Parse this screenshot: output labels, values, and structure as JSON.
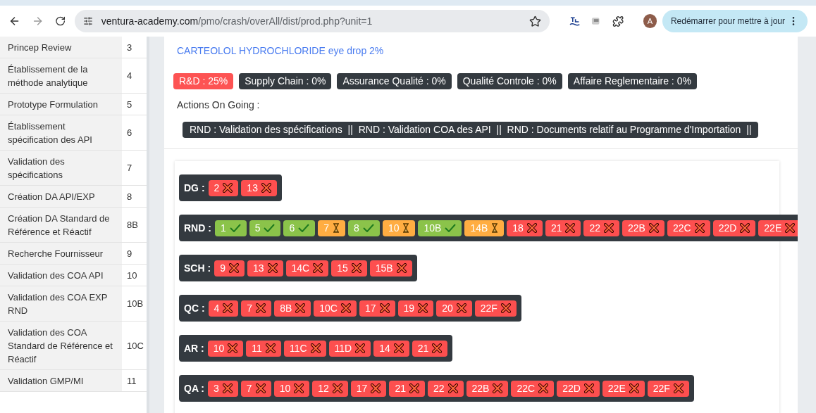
{
  "browser": {
    "url_host": "ventura-academy.com",
    "url_path": "/pmo/crash/overAll/dist/prod.php?unit=1",
    "avatar": "A",
    "update_button": "Redémarrer pour mettre à jour"
  },
  "steps_table": {
    "rows": [
      {
        "name": "Princep Review",
        "code": "3"
      },
      {
        "name": "Établissement de la méthode analytique",
        "code": "4"
      },
      {
        "name": "Prototype Formulation",
        "code": "5"
      },
      {
        "name": "Établissement spécification des API",
        "code": "6"
      },
      {
        "name": "Validation des spécifications",
        "code": "7"
      },
      {
        "name": "Création DA API/EXP",
        "code": "8"
      },
      {
        "name": "Création DA Standard de Référence et Réactif",
        "code": "8B"
      },
      {
        "name": "Recherche Fournisseur",
        "code": "9"
      },
      {
        "name": "Validation des COA API",
        "code": "10"
      },
      {
        "name": "Validation des COA EXP RND",
        "code": "10B"
      },
      {
        "name": "Validation des COA Standard de Référence et Réactif",
        "code": "10C"
      },
      {
        "name": "Validation GMP/MI",
        "code": "11"
      }
    ]
  },
  "product": {
    "title": "CARTEOLOL HYDROCHLORIDE eye drop 2%",
    "departments": [
      {
        "label": "R&D : 25%",
        "color": "#fd5353"
      },
      {
        "label": "Supply Chain : 0%",
        "color": "#343a40"
      },
      {
        "label": "Assurance Qualité : 0%",
        "color": "#343a40"
      },
      {
        "label": "Qualité Controle : 0%",
        "color": "#343a40"
      },
      {
        "label": "Affaire Reglementaire : 0%",
        "color": "#343a40"
      }
    ],
    "actions_label": "Actions On Going :",
    "actions": "RND : Validation des spécifications  ||  RND : Validation COA des API  ||  RND : Documents relatif au Programme d'Importation  ||"
  },
  "groups": [
    {
      "label": "DG :",
      "tasks": [
        {
          "code": "2",
          "kind": "todo"
        },
        {
          "code": "13",
          "kind": "todo"
        }
      ]
    },
    {
      "label": "RND :",
      "tasks": [
        {
          "code": "1",
          "kind": "done"
        },
        {
          "code": "5",
          "kind": "done"
        },
        {
          "code": "6",
          "kind": "done"
        },
        {
          "code": "7",
          "kind": "pending"
        },
        {
          "code": "8",
          "kind": "done"
        },
        {
          "code": "10",
          "kind": "pending"
        },
        {
          "code": "10B",
          "kind": "done"
        },
        {
          "code": "14B",
          "kind": "pending"
        },
        {
          "code": "18",
          "kind": "todo"
        },
        {
          "code": "21",
          "kind": "todo"
        },
        {
          "code": "22",
          "kind": "todo"
        },
        {
          "code": "22B",
          "kind": "todo"
        },
        {
          "code": "22C",
          "kind": "todo"
        },
        {
          "code": "22D",
          "kind": "todo"
        },
        {
          "code": "22E",
          "kind": "todo"
        }
      ]
    },
    {
      "label": "SCH :",
      "tasks": [
        {
          "code": "9",
          "kind": "todo"
        },
        {
          "code": "13",
          "kind": "todo"
        },
        {
          "code": "14C",
          "kind": "todo"
        },
        {
          "code": "15",
          "kind": "todo"
        },
        {
          "code": "15B",
          "kind": "todo"
        }
      ]
    },
    {
      "label": "QC :",
      "tasks": [
        {
          "code": "4",
          "kind": "todo"
        },
        {
          "code": "7",
          "kind": "todo"
        },
        {
          "code": "8B",
          "kind": "todo"
        },
        {
          "code": "10C",
          "kind": "todo"
        },
        {
          "code": "17",
          "kind": "todo"
        },
        {
          "code": "19",
          "kind": "todo"
        },
        {
          "code": "20",
          "kind": "todo"
        },
        {
          "code": "22F",
          "kind": "todo"
        }
      ]
    },
    {
      "label": "AR :",
      "tasks": [
        {
          "code": "10",
          "kind": "todo"
        },
        {
          "code": "11",
          "kind": "todo"
        },
        {
          "code": "11C",
          "kind": "todo"
        },
        {
          "code": "11D",
          "kind": "todo"
        },
        {
          "code": "14",
          "kind": "todo"
        },
        {
          "code": "21",
          "kind": "todo"
        }
      ]
    },
    {
      "label": "QA :",
      "tasks": [
        {
          "code": "3",
          "kind": "todo"
        },
        {
          "code": "7",
          "kind": "todo"
        },
        {
          "code": "10",
          "kind": "todo"
        },
        {
          "code": "12",
          "kind": "todo"
        },
        {
          "code": "17",
          "kind": "todo"
        },
        {
          "code": "21",
          "kind": "todo"
        },
        {
          "code": "22",
          "kind": "todo"
        },
        {
          "code": "22B",
          "kind": "todo"
        },
        {
          "code": "22C",
          "kind": "todo"
        },
        {
          "code": "22D",
          "kind": "todo"
        },
        {
          "code": "22E",
          "kind": "todo"
        },
        {
          "code": "22F",
          "kind": "todo"
        }
      ]
    }
  ]
}
